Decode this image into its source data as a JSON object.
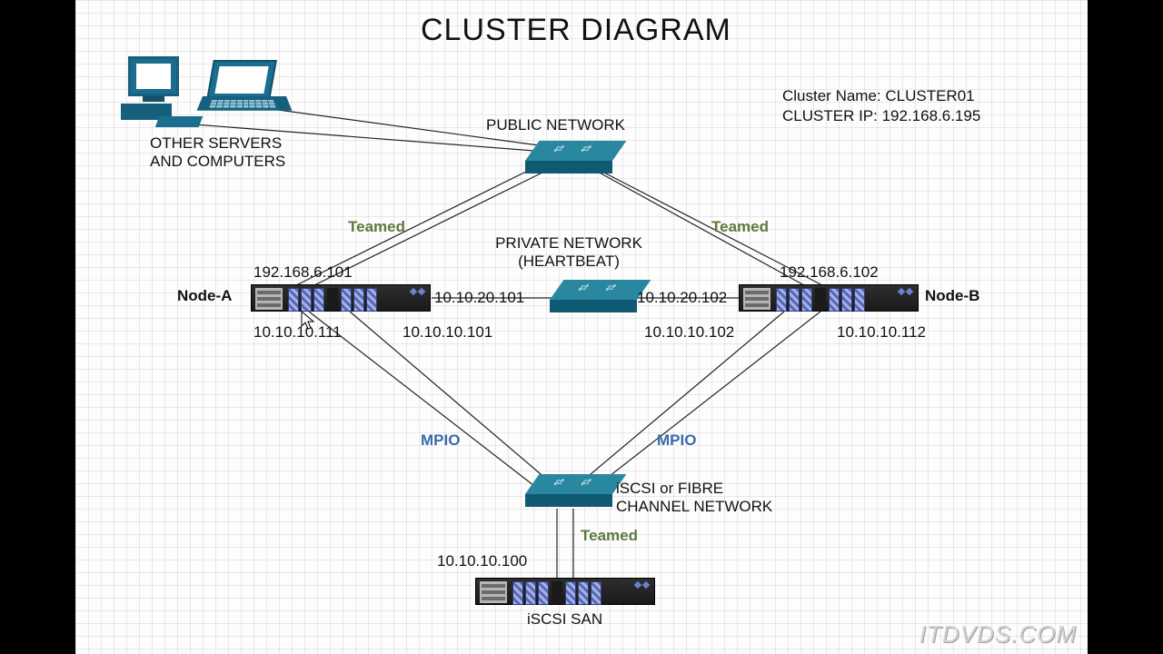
{
  "title": "CLUSTER DIAGRAM",
  "labels": {
    "other_servers_l1": "OTHER SERVERS",
    "other_servers_l2": "AND COMPUTERS",
    "public_network": "PUBLIC NETWORK",
    "private_network_l1": "PRIVATE NETWORK",
    "private_network_l2": "(HEARTBEAT)",
    "teamed": "Teamed",
    "mpio": "MPIO",
    "storage_net_l1": "iSCSI or FIBRE",
    "storage_net_l2": "CHANNEL NETWORK",
    "iscsi_san": "iSCSI SAN",
    "node_a": "Node-A",
    "node_b": "Node-B",
    "cluster_name": "Cluster Name: CLUSTER01",
    "cluster_ip": "CLUSTER IP: 192.168.6.195"
  },
  "ips": {
    "node_a_public": "192.168.6.101",
    "node_b_public": "192.168.6.102",
    "node_a_hb": "10.10.20.101",
    "node_b_hb": "10.10.20.102",
    "node_a_iscsi_1": "10.10.10.111",
    "node_a_iscsi_2": "10.10.10.101",
    "node_b_iscsi_1": "10.10.10.102",
    "node_b_iscsi_2": "10.10.10.112",
    "san": "10.10.10.100"
  },
  "watermark": "ITDVDS.COM"
}
